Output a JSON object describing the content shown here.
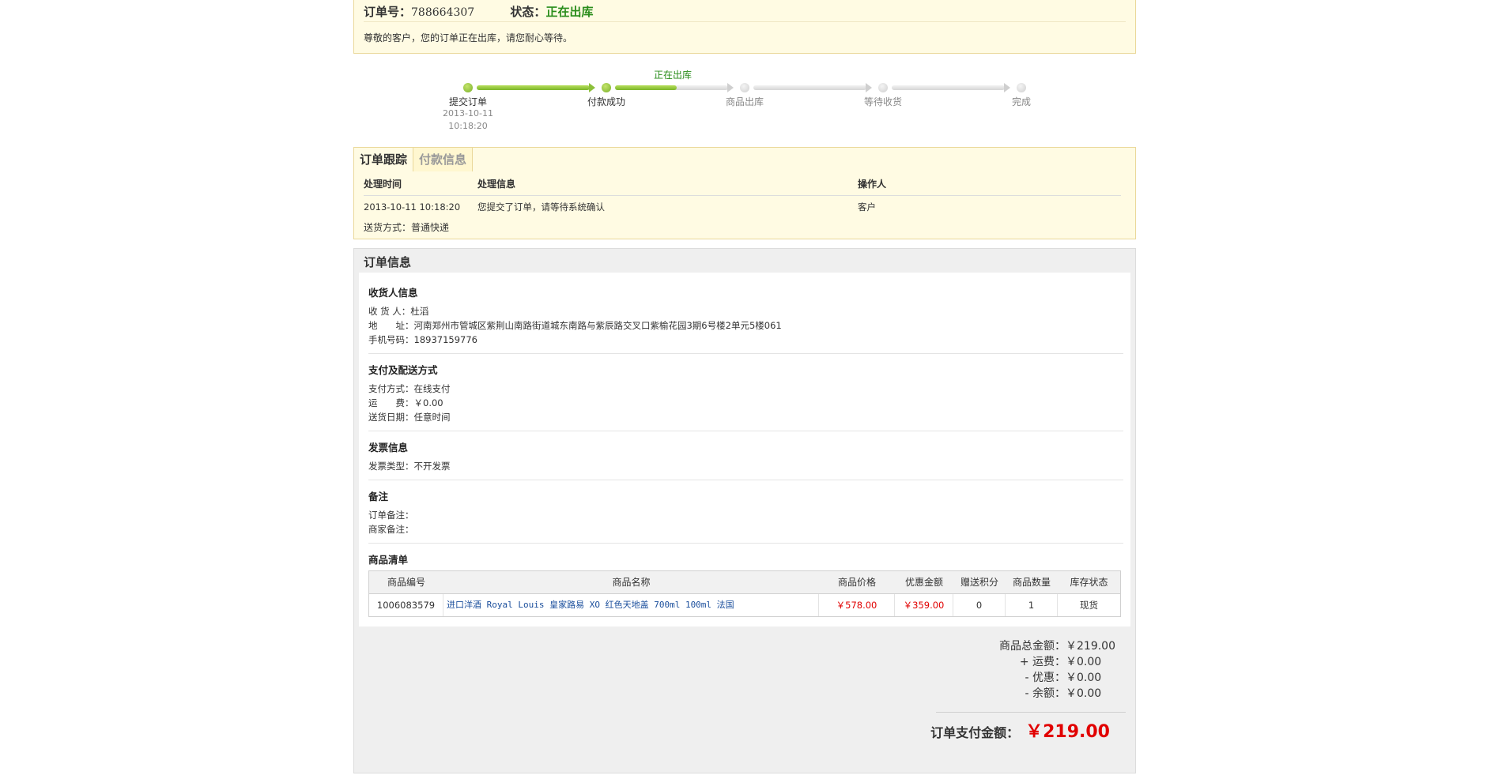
{
  "order": {
    "number_label": "订单号：",
    "number": "788664307",
    "status_label": "状态：",
    "status": "正在出库",
    "message": "尊敬的客户，您的订单正在出库，请您耐心等待。"
  },
  "progress": {
    "current_label": "正在出库",
    "steps": [
      {
        "label": "提交订单",
        "date": "2013-10-11",
        "time": "10:18:20",
        "done": true
      },
      {
        "label": "付款成功",
        "done": true
      },
      {
        "label": "商品出库",
        "done": false
      },
      {
        "label": "等待收货",
        "done": false
      },
      {
        "label": "完成",
        "done": false
      }
    ],
    "colors": {
      "done": "#79b02a",
      "current_text": "#2a8d1b"
    }
  },
  "tracking": {
    "tabs": [
      {
        "label": "订单跟踪",
        "active": true
      },
      {
        "label": "付款信息",
        "active": false
      }
    ],
    "headers": {
      "time": "处理时间",
      "info": "处理信息",
      "operator": "操作人"
    },
    "rows": [
      {
        "time": "2013-10-11 10:18:20",
        "info": "您提交了订单，请等待系统确认",
        "operator": "客户"
      }
    ],
    "shipping": "送货方式：普通快递"
  },
  "order_info": {
    "title": "订单信息",
    "consignee": {
      "title": "收货人信息",
      "name": "收 货 人：杜滔",
      "address": "地　　址：河南郑州市管城区紫荆山南路街道城东南路与紫辰路交叉口紫榆花园3期6号楼2单元5楼061",
      "phone": "手机号码：18937159776"
    },
    "payment": {
      "title": "支付及配送方式",
      "method": "支付方式：在线支付",
      "fee": "运　　费：￥0.00",
      "date": "送货日期：任意时间"
    },
    "invoice": {
      "title": "发票信息",
      "type": "发票类型：不开发票"
    },
    "remark": {
      "title": "备注",
      "order": "订单备注：",
      "merchant": "商家备注："
    },
    "goods": {
      "title": "商品清单",
      "headers": [
        "商品编号",
        "商品名称",
        "商品价格",
        "优惠金额",
        "赠送积分",
        "商品数量",
        "库存状态"
      ],
      "rows": [
        {
          "sku": "1006083579",
          "name": "进口洋酒 Royal Louis 皇家路易 XO 红色天地盖 700ml 100ml 法国",
          "price": "￥578.00",
          "discount": "￥359.00",
          "points": "0",
          "qty": "1",
          "stock": "现货"
        }
      ]
    },
    "summary": {
      "goods_total_label": "商品总金额：",
      "goods_total": "￥219.00",
      "shipping_label": "+ 运费：",
      "shipping": "￥0.00",
      "discount_label": "- 优惠：",
      "discount": "￥0.00",
      "balance_label": "- 余额：",
      "balance": "￥0.00",
      "pay_label": "订单支付金额：",
      "pay": "￥219.00"
    }
  }
}
